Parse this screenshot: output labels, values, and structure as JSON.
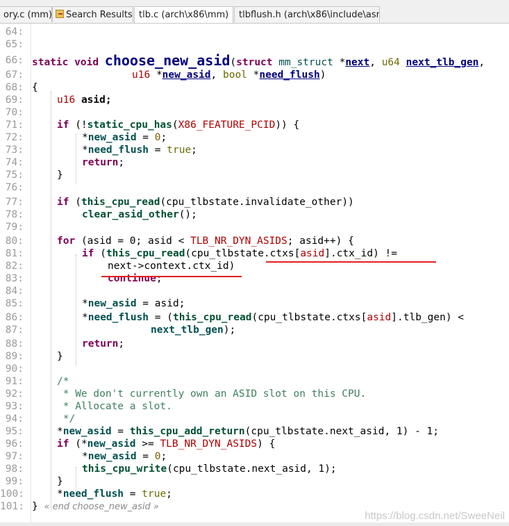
{
  "tabs": [
    {
      "label": "ory.c (mm)",
      "active": false
    },
    {
      "label": "Search Results",
      "active": false,
      "icon": "search-results-icon"
    },
    {
      "label": "tlb.c (arch\\x86\\mm)",
      "active": true,
      "close": "×"
    },
    {
      "label": "tlbflush.h (arch\\x86\\include\\asm)",
      "active": false
    }
  ],
  "editor": {
    "line_numbers": [
      "64:",
      "65:",
      "66:",
      "67:",
      "68:",
      "69:",
      "70:",
      "71:",
      "72:",
      "73:",
      "74:",
      "75:",
      "76:",
      "77:",
      "78:",
      "79:",
      "80:",
      "81:",
      "82:",
      "83:",
      "84:",
      "85:",
      "86:",
      "87:",
      "88:",
      "89:",
      "90:",
      "91:",
      "92:",
      "93:",
      "94:",
      "95:",
      "96:",
      "97:",
      "98:",
      "99:",
      "100:",
      "101:"
    ],
    "tokens": {
      "static": "static",
      "void": "void",
      "func": "choose_new_asid",
      "lparen": "(",
      "rparen": ")",
      "struct": "struct",
      "mm_struct": "mm_struct",
      "star": "*",
      "next": "next",
      "comma": ",",
      "u64": "u64",
      "next_tlb_gen": "next_tlb_gen",
      "u16": "u16",
      "new_asid": "new_asid",
      "bool": "bool",
      "need_flush": "need_flush",
      "lbrace": "{",
      "rbrace": "}",
      "asid_decl": "asid;",
      "if": "if",
      "not": "(!",
      "static_cpu_has": "static_cpu_has",
      "x86_feature_pcid": "X86_FEATURE_PCID",
      "close_brace": ")) {",
      "assign_zero": " = ",
      "zero": "0",
      "semi": ";",
      "true": "true",
      "return": "return",
      "this_cpu_read": "this_cpu_read",
      "invalidate_other": "(cpu_tlbstate.invalidate_other))",
      "clear_asid_other": "clear_asid_other",
      "clear_tail": "();",
      "for": "for",
      "asid": "asid",
      "for_mid": " = 0; asid < ",
      "tlb_nr_dyn_asids": "TLB_NR_DYN_ASIDS",
      "for_tail": "; asid++) {",
      "ctxs_pre": "(cpu_tlbstate.ctxs[",
      "ctx_id_tail": "].ctx_id) !=",
      "next_arrow": "next->",
      "context_ctx_id": "context.ctx_id",
      "continue": "continue",
      "assign": " = ",
      "asid_semi": "asid;",
      "tlb_gen_tail": "].tlb_gen) <",
      "next_tlb_gen_tail": ");",
      "comment_open": "/*",
      "comment_line1": " * We don't currently own an ASID slot on this CPU.",
      "comment_line2": " * Allocate a slot.",
      "comment_close": " */",
      "this_cpu_add_return": "this_cpu_add_return",
      "add_return_args": "(cpu_tlbstate.next_asid, 1) - 1;",
      "ge": " >= ",
      "ge_tail": ") {",
      "this_cpu_write": "this_cpu_write",
      "write_args": "(cpu_tlbstate.next_asid, 1);",
      "fold_end": "« end choose_new_asid »"
    }
  },
  "watermark": "https://blog.csdn.net/SweeNeil",
  "colors": {
    "keyword": "#7f0055",
    "annotation": "#e02020",
    "macro": "#b00000",
    "comment": "#3f7f5f"
  }
}
